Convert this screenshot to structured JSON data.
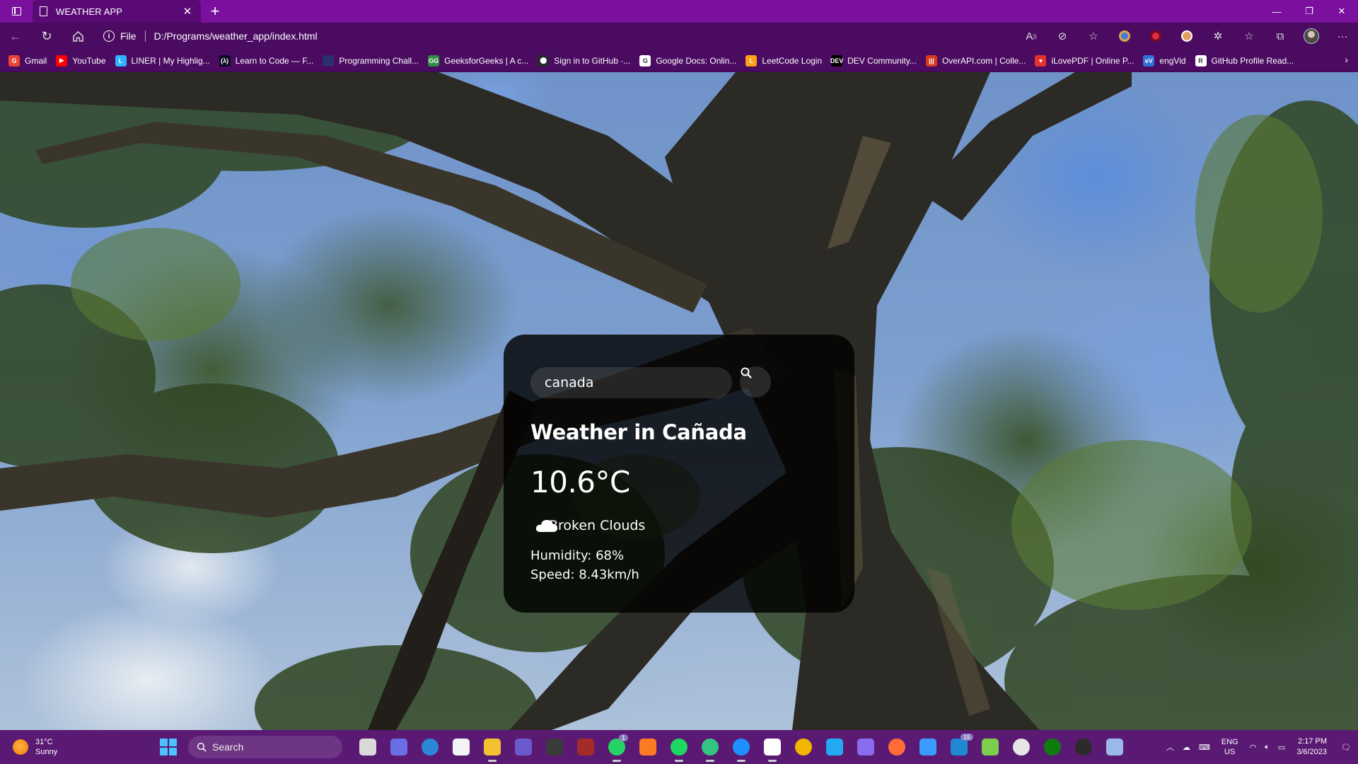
{
  "browser": {
    "tab_title": "WEATHER APP",
    "url_scheme": "File",
    "url": "D:/Programs/weather_app/index.html",
    "bookmarks": [
      {
        "label": "Gmail",
        "icon": "gmail-icon",
        "color": "#ea4335",
        "glyph": "G"
      },
      {
        "label": "YouTube",
        "icon": "youtube-icon",
        "color": "#ff0000",
        "glyph": "▶"
      },
      {
        "label": "LINER | My Highlig...",
        "icon": "liner-icon",
        "color": "#2fb3ff",
        "glyph": "L"
      },
      {
        "label": "Learn to Code — F...",
        "icon": "freecodecamp-icon",
        "color": "#0a0a23",
        "glyph": "(λ)"
      },
      {
        "label": "Programming Chall...",
        "icon": "programming-challenges-icon",
        "color": "#2c2f6e",
        "glyph": ""
      },
      {
        "label": "GeeksforGeeks | A c...",
        "icon": "geeksforgeeks-icon",
        "color": "#2f8d46",
        "glyph": "GG"
      },
      {
        "label": "Sign in to GitHub ·...",
        "icon": "github-icon",
        "color": "#24292e",
        "glyph": "⬤"
      },
      {
        "label": "Google Docs: Onlin...",
        "icon": "google-icon",
        "color": "#ffffff",
        "glyph": "G"
      },
      {
        "label": "LeetCode Login",
        "icon": "leetcode-icon",
        "color": "#ffa116",
        "glyph": "L"
      },
      {
        "label": "DEV Community...",
        "icon": "dev-icon",
        "color": "#000000",
        "glyph": "DEV"
      },
      {
        "label": "OverAPI.com | Colle...",
        "icon": "overapi-icon",
        "color": "#d9381e",
        "glyph": "|||"
      },
      {
        "label": "iLovePDF | Online P...",
        "icon": "ilovepdf-icon",
        "color": "#e5322d",
        "glyph": "♥"
      },
      {
        "label": "engVid",
        "icon": "engvid-icon",
        "color": "#2f6fd6",
        "glyph": "eV"
      },
      {
        "label": "GitHub Profile Read...",
        "icon": "readme-icon",
        "color": "#ffffff",
        "glyph": "R"
      }
    ]
  },
  "weather": {
    "search_value": "canada",
    "city_heading": "Weather in Cañada",
    "temperature": "10.6°C",
    "description": "Broken Clouds",
    "humidity": "Humidity: 68%",
    "wind": "Speed: 8.43km/h"
  },
  "taskbar": {
    "weather_temp": "31°C",
    "weather_cond": "Sunny",
    "search_label": "Search",
    "lang_top": "ENG",
    "lang_bottom": "US",
    "time": "2:17 PM",
    "date": "3/6/2023",
    "teams_badge": "1",
    "mail_badge": "15",
    "apps": [
      {
        "name": "task-view-icon",
        "color": "#d9d9d9"
      },
      {
        "name": "teams-chat-icon",
        "color": "#6b6fe6"
      },
      {
        "name": "cortana-icon",
        "color": "#2b88d8"
      },
      {
        "name": "microsoft-store-icon",
        "color": "#f3f3f3"
      },
      {
        "name": "file-explorer-icon",
        "color": "#f2c230"
      },
      {
        "name": "visual-studio-icon",
        "color": "#6a5acd"
      },
      {
        "name": "unity-icon",
        "color": "#3a3a3a"
      },
      {
        "name": "toolbox-icon",
        "color": "#a52a2a"
      },
      {
        "name": "whatsapp-icon",
        "color": "#25d366"
      },
      {
        "name": "xampp-icon",
        "color": "#fb7a24"
      },
      {
        "name": "spotify-icon",
        "color": "#1ed760"
      },
      {
        "name": "edge-icon",
        "color": "#33c481"
      },
      {
        "name": "edge-dev-icon",
        "color": "#1e90ff"
      },
      {
        "name": "notion-icon",
        "color": "#ffffff"
      },
      {
        "name": "chrome-icon",
        "color": "#f2b600"
      },
      {
        "name": "vscode-icon",
        "color": "#23a9f2"
      },
      {
        "name": "git-client-icon",
        "color": "#8a6cf0"
      },
      {
        "name": "postman-icon",
        "color": "#ff6c37"
      },
      {
        "name": "todo-icon",
        "color": "#3b9cff"
      },
      {
        "name": "mail-icon",
        "color": "#1f8ad2"
      },
      {
        "name": "notepad-icon",
        "color": "#7ccf4d"
      },
      {
        "name": "clock-app-icon",
        "color": "#e6e6e6"
      },
      {
        "name": "xbox-icon",
        "color": "#107c10"
      },
      {
        "name": "obs-icon",
        "color": "#2b2b2b"
      },
      {
        "name": "save-app-icon",
        "color": "#9ab8e8"
      }
    ]
  }
}
